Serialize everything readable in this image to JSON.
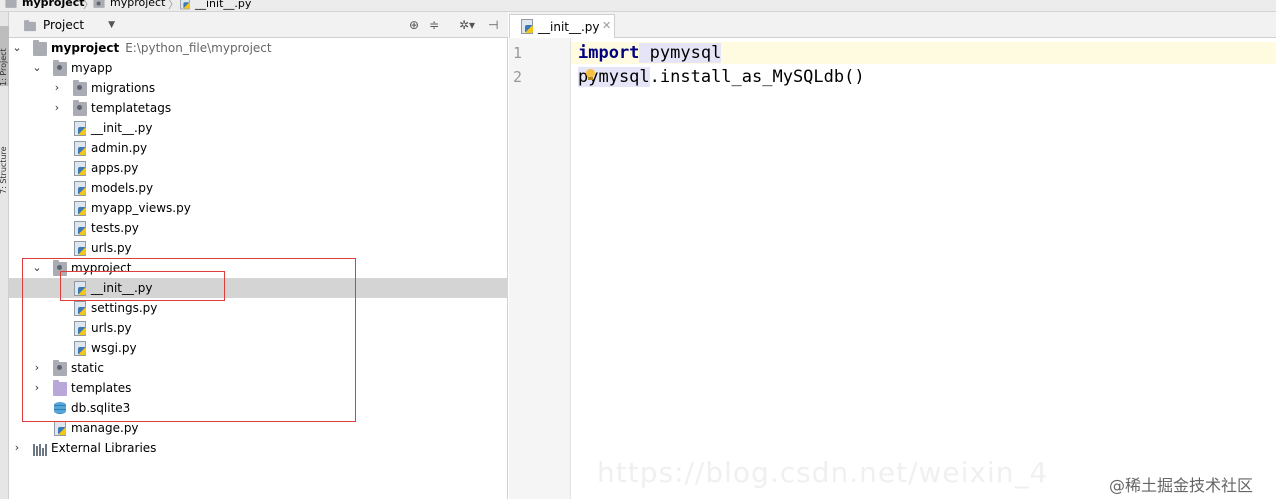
{
  "breadcrumb": {
    "items": [
      "myproject",
      "myproject",
      "__init__.py"
    ],
    "separator": "〉"
  },
  "side_strip": {
    "project_tab": "1: Project",
    "structure_tab": "7: Structure"
  },
  "project_panel": {
    "title": "Project",
    "toolbar_icons": [
      "target-icon",
      "collapse-icon",
      "gear-icon",
      "hide-icon"
    ],
    "tree": [
      {
        "label": "myproject",
        "path": "E:\\python_file\\myproject",
        "type": "folder",
        "expanded": true,
        "bold": true
      },
      {
        "label": "myapp",
        "type": "package",
        "expanded": true
      },
      {
        "label": "migrations",
        "type": "package",
        "expanded": false
      },
      {
        "label": "templatetags",
        "type": "package",
        "expanded": false
      },
      {
        "label": "__init__.py",
        "type": "python"
      },
      {
        "label": "admin.py",
        "type": "python"
      },
      {
        "label": "apps.py",
        "type": "python"
      },
      {
        "label": "models.py",
        "type": "python"
      },
      {
        "label": "myapp_views.py",
        "type": "python"
      },
      {
        "label": "tests.py",
        "type": "python"
      },
      {
        "label": "urls.py",
        "type": "python"
      },
      {
        "label": "myproject",
        "type": "package",
        "expanded": true
      },
      {
        "label": "__init__.py",
        "type": "python",
        "selected": true
      },
      {
        "label": "settings.py",
        "type": "python"
      },
      {
        "label": "urls.py",
        "type": "python"
      },
      {
        "label": "wsgi.py",
        "type": "python"
      },
      {
        "label": "static",
        "type": "package",
        "expanded": false
      },
      {
        "label": "templates",
        "type": "templates-folder",
        "expanded": false
      },
      {
        "label": "db.sqlite3",
        "type": "database"
      },
      {
        "label": "manage.py",
        "type": "python"
      },
      {
        "label": "External Libraries",
        "type": "libraries",
        "expanded": false
      }
    ]
  },
  "editor": {
    "tab_label": "__init__.py",
    "line_numbers": [
      "1",
      "2"
    ],
    "lines": {
      "line1_kw": "import",
      "line1_rest": " pymysql",
      "line2_obj": "pymysql",
      "line2_rest": ".install_as_MySQLdb()"
    }
  },
  "watermark": {
    "text": "@稀土掘金技术社区",
    "url_text": "https://blog.csdn.net/weixin_4"
  },
  "colors": {
    "keyword": "#000080",
    "selection_row": "#d4d4d4",
    "highlight_box": "#e03c3c",
    "current_line": "#fffbe0"
  }
}
